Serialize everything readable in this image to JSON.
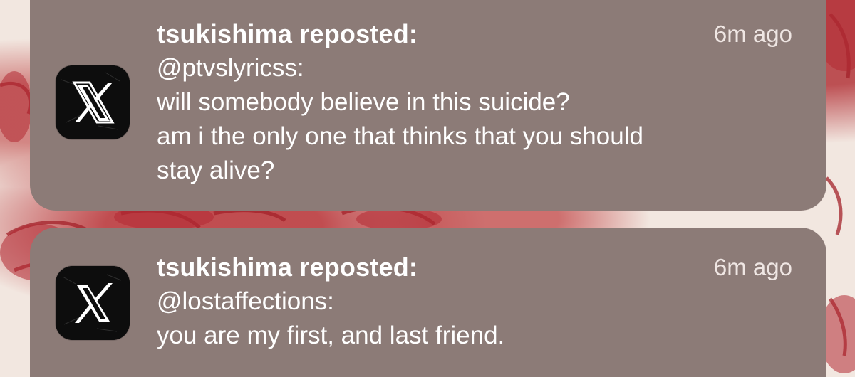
{
  "notifications": [
    {
      "app_icon": "x-logo-icon",
      "title": "tsukishima reposted:",
      "time": "6m ago",
      "lines": [
        "@ptvslyricss:",
        "will somebody believe in this suicide?",
        "am i the only one that thinks that you should",
        "stay alive?"
      ]
    },
    {
      "app_icon": "x-logo-icon",
      "title": "tsukishima reposted:",
      "time": "6m ago",
      "lines": [
        "@lostaffections:",
        "you are my first, and last friend."
      ]
    }
  ],
  "colors": {
    "card_background": "#8c7b77",
    "text": "#ffffff",
    "icon_background": "#0d0d0d"
  }
}
